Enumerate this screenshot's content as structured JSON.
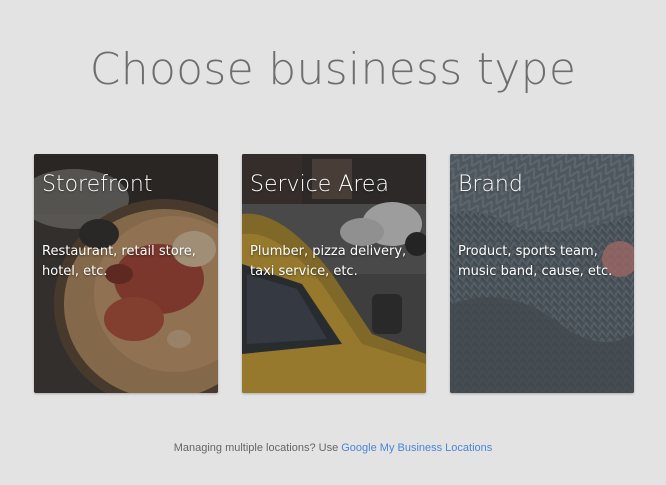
{
  "page": {
    "title": "Choose business type"
  },
  "cards": [
    {
      "title": "Storefront",
      "description": "Restaurant, retail store, hotel, etc.",
      "image": "pizza-photo"
    },
    {
      "title": "Service Area",
      "description": "Plumber, pizza delivery, taxi service, etc.",
      "image": "scooter-taxi-photo"
    },
    {
      "title": "Brand",
      "description": "Product, sports team, music band, cause, etc.",
      "image": "knit-sweater-photo"
    }
  ],
  "footer": {
    "text": "Managing multiple locations? Use ",
    "link_label": "Google My Business Locations"
  },
  "colors": {
    "background": "#e3e3e3",
    "title_text": "#6e6e6e",
    "link": "#4a86d8"
  }
}
